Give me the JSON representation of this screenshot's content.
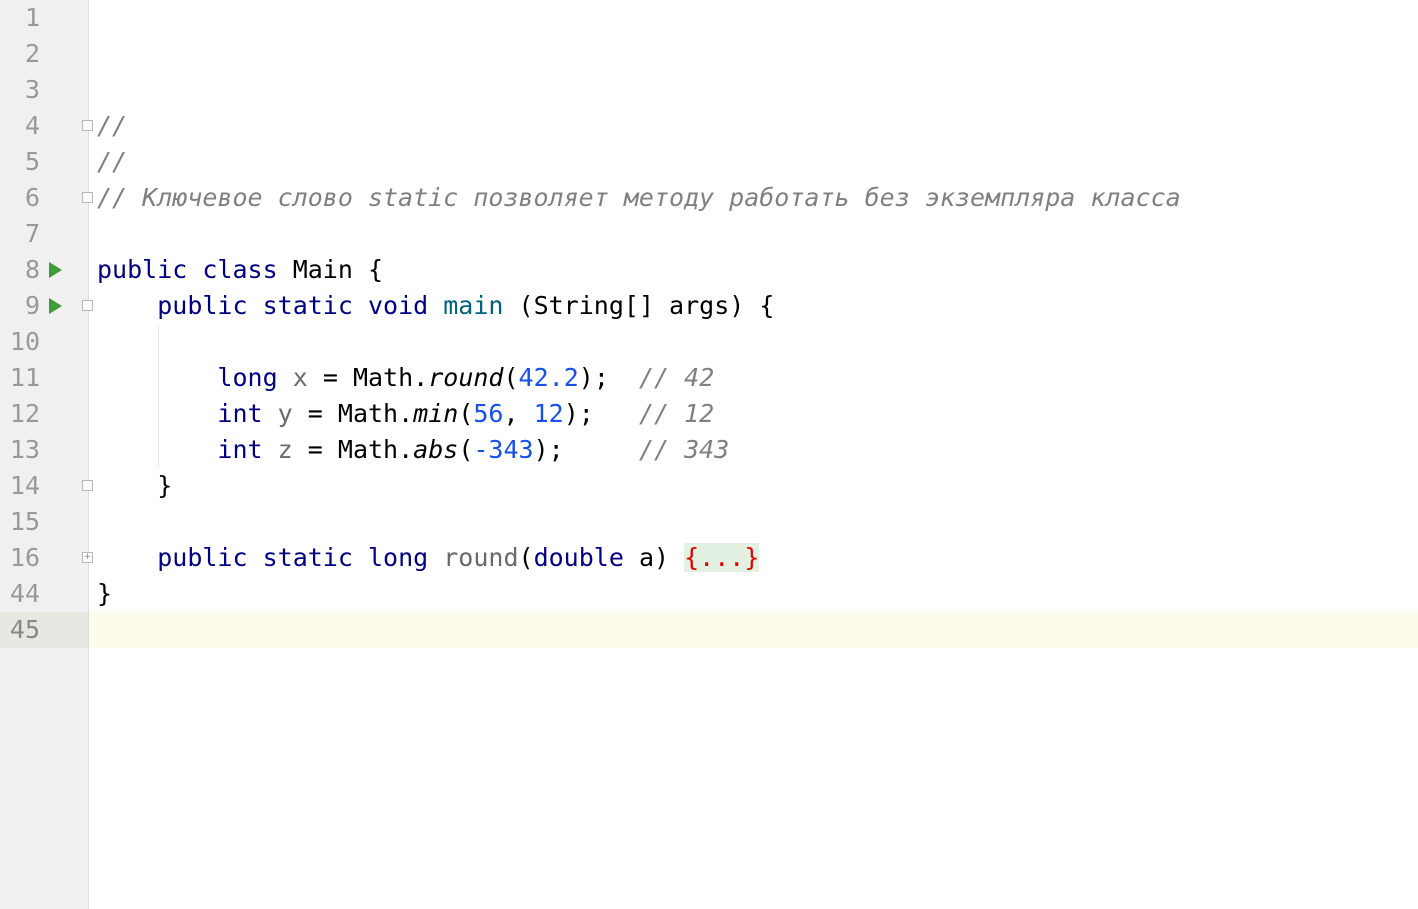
{
  "gutter": {
    "line_numbers": [
      "1",
      "2",
      "3",
      "4",
      "5",
      "6",
      "7",
      "8",
      "9",
      "10",
      "11",
      "12",
      "13",
      "14",
      "15",
      "16",
      "44",
      "45"
    ],
    "run_icon": "run-triangle-icon",
    "fold_icon": "fold-marker-icon"
  },
  "code": {
    "line4": {
      "comment": "//"
    },
    "line5": {
      "comment": "//"
    },
    "line6": {
      "comment": "// Ключевое слово static позволяет методу работать без экземпляра класса"
    },
    "line8": {
      "kw1": "public",
      "kw2": "class",
      "name": "Main",
      "brace": "{"
    },
    "line9": {
      "kw1": "public",
      "kw2": "static",
      "kw3": "void",
      "method": "main",
      "params": "(String[] args)",
      "brace": "{"
    },
    "line11": {
      "type": "long",
      "var": "x",
      "eq": "=",
      "obj": "Math.",
      "call": "round",
      "lp": "(",
      "arg": "42.2",
      "rp": ");",
      "comment": "// 42"
    },
    "line12": {
      "type": "int",
      "var": "y",
      "eq": "=",
      "obj": "Math.",
      "call": "min",
      "lp": "(",
      "arg1": "56",
      "comma": ", ",
      "arg2": "12",
      "rp": ");",
      "comment": "// 12"
    },
    "line13": {
      "type": "int",
      "var": "z",
      "eq": "=",
      "obj": "Math.",
      "call": "abs",
      "lp": "(",
      "arg": "-343",
      "rp": ");",
      "comment": "// 343"
    },
    "line14": {
      "brace": "}"
    },
    "line16": {
      "kw1": "public",
      "kw2": "static",
      "kw3": "long",
      "method": "round",
      "lp": "(",
      "ptype": "double",
      "pname": " a)",
      "folded": "{...}"
    },
    "line44": {
      "brace": "}"
    }
  },
  "colors": {
    "keyword": "#000080",
    "comment": "#808080",
    "number": "#1750eb",
    "folded_text": "#e30000",
    "current_line": "#fdfbe9",
    "run_icon": "#3f9a3b"
  }
}
